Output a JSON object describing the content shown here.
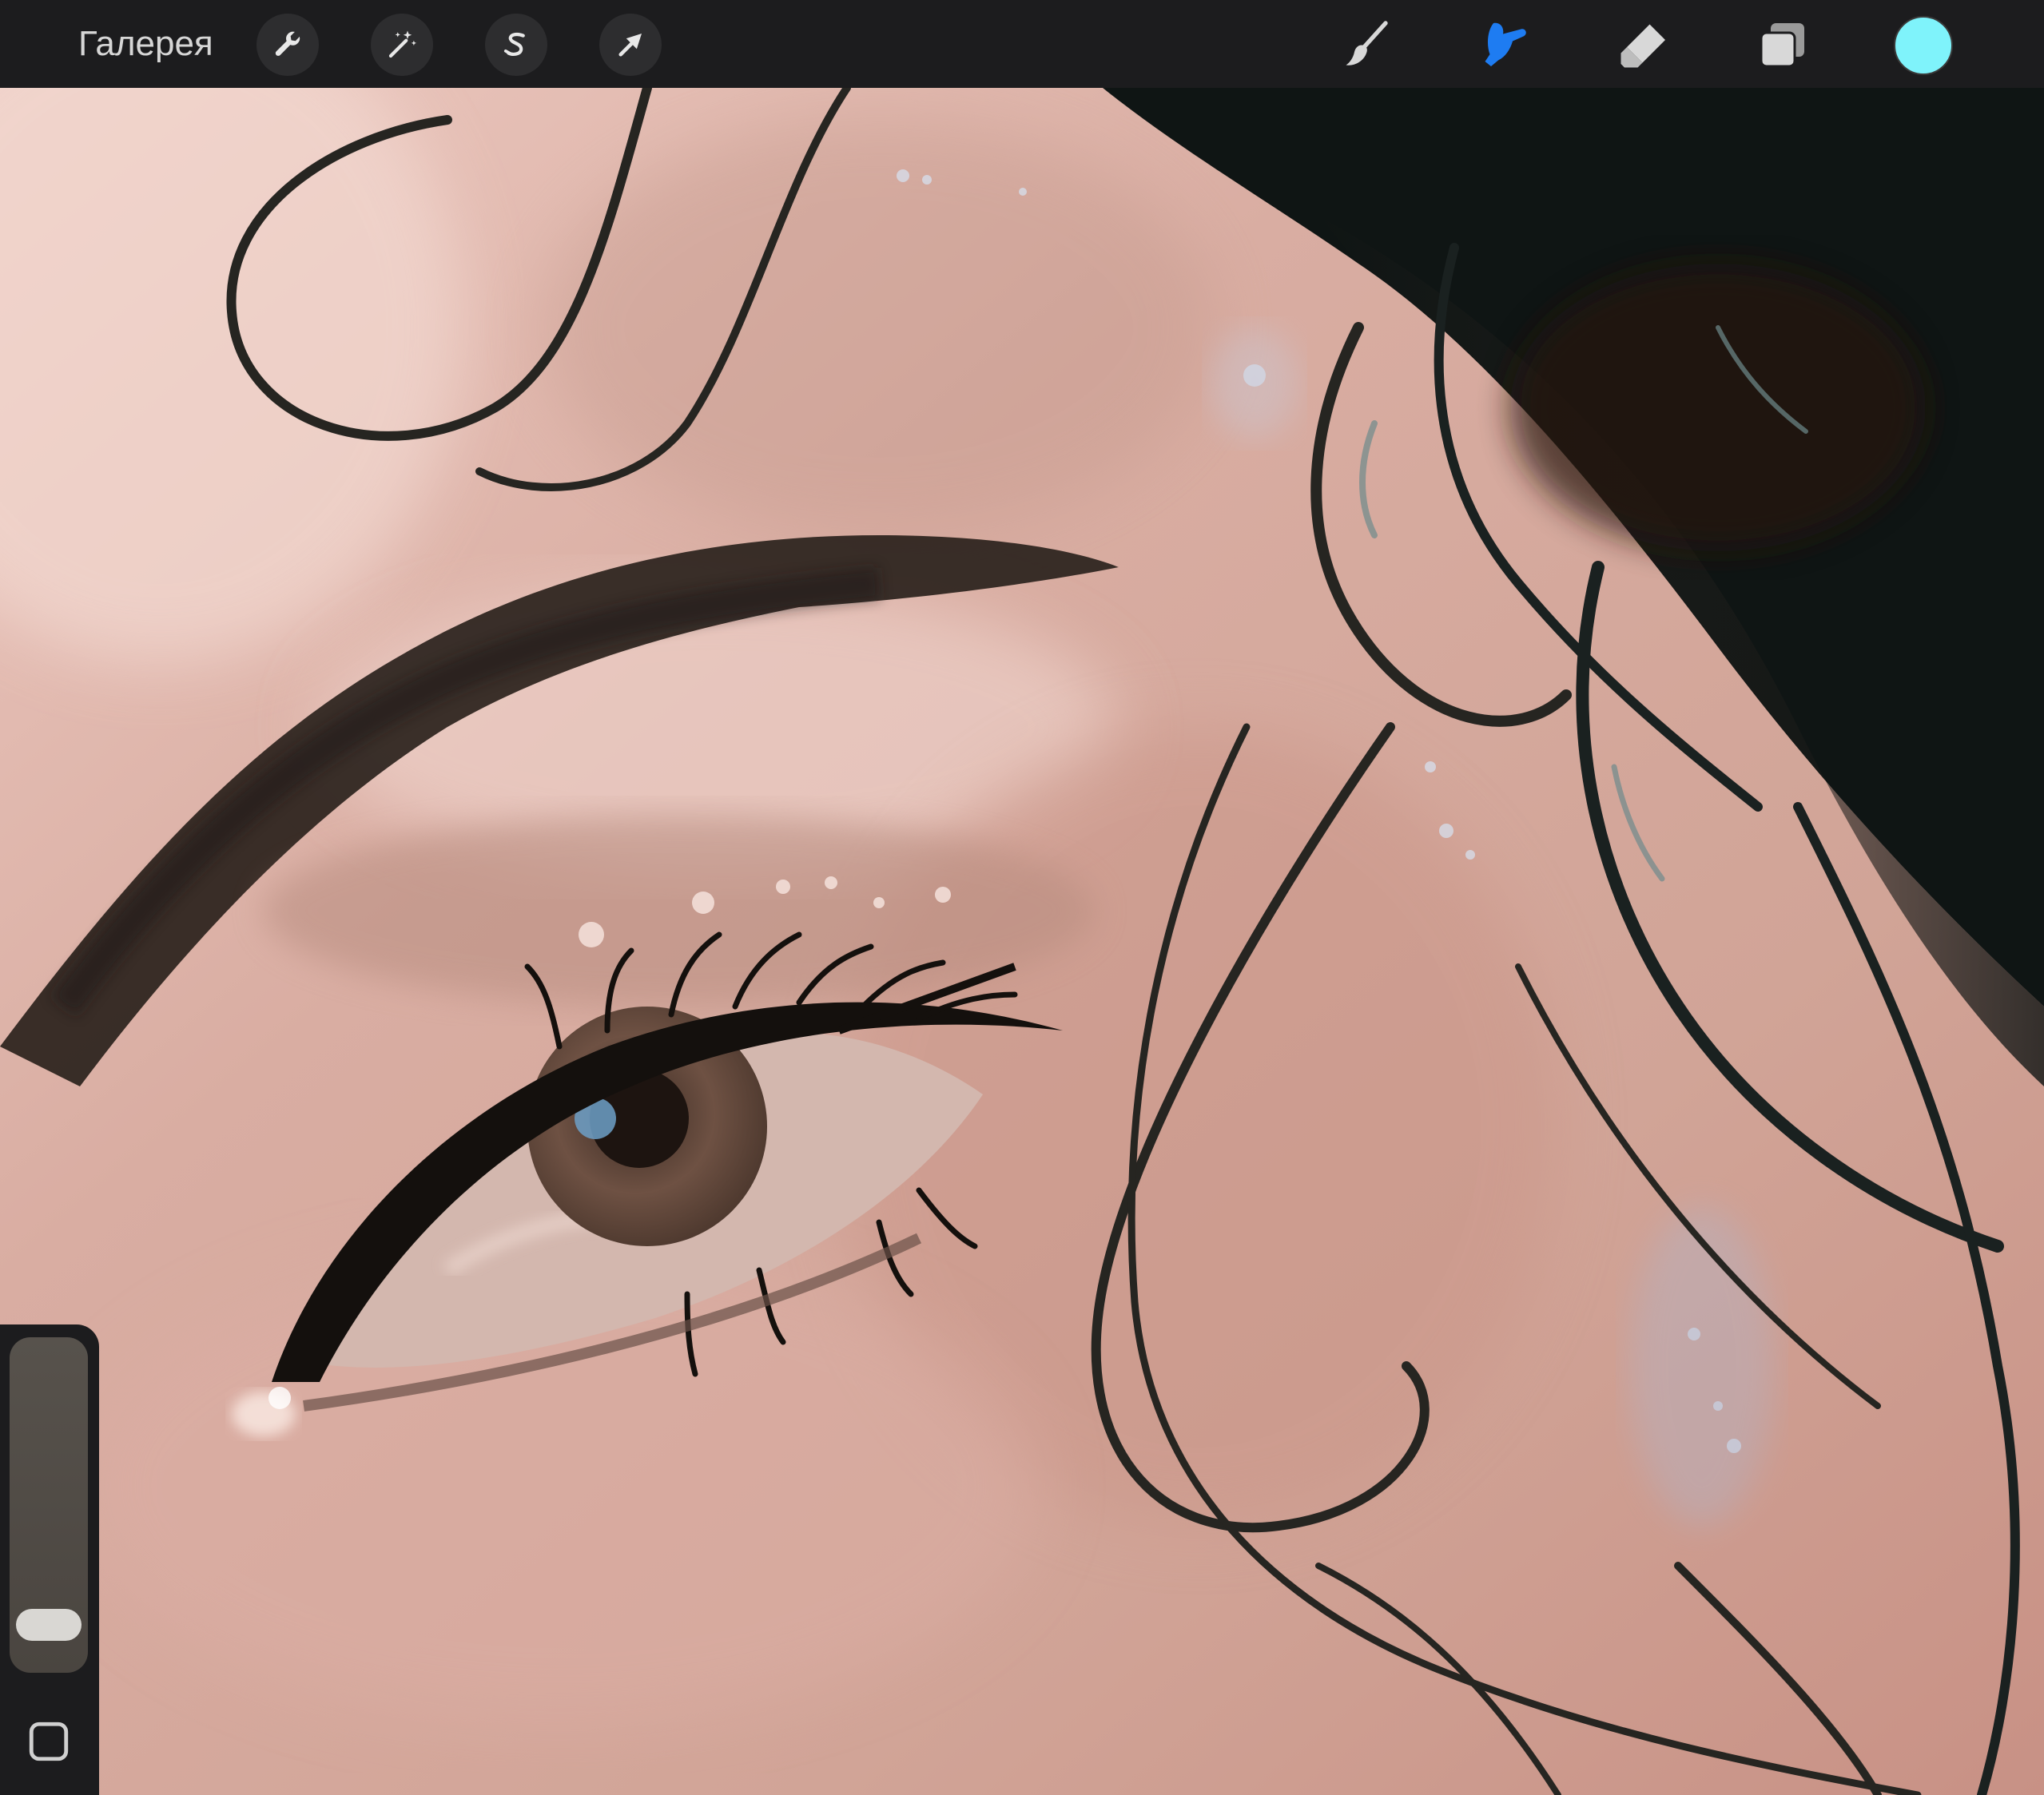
{
  "toolbar": {
    "gallery_label": "Галерея",
    "left_tools": [
      {
        "name": "actions",
        "icon": "wrench-icon"
      },
      {
        "name": "adjustments",
        "icon": "magic-wand-icon"
      },
      {
        "name": "selection",
        "icon": "selection-s-icon"
      },
      {
        "name": "transform",
        "icon": "arrow-cursor-icon"
      }
    ],
    "right_tools": [
      {
        "name": "brush",
        "icon": "brush-icon",
        "active": false
      },
      {
        "name": "smudge",
        "icon": "smudge-finger-icon",
        "active": true
      },
      {
        "name": "eraser",
        "icon": "eraser-icon",
        "active": false
      },
      {
        "name": "layers",
        "icon": "layers-icon",
        "active": false
      }
    ],
    "current_color": "#7ff3fb",
    "active_tool_color": "#1e7cf2"
  },
  "sidebar": {
    "brush_size_level": 0.08,
    "modify_icon": "square-modify-icon"
  }
}
